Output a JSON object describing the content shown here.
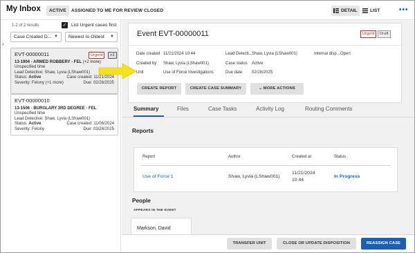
{
  "app": {
    "title": "My Inbox"
  },
  "top_tabs": [
    {
      "label": "ACTIVE"
    },
    {
      "label": "ASSIGNED TO ME FOR REVIEW"
    },
    {
      "label": "CLOSED"
    }
  ],
  "view": {
    "detail_label": "DETAIL",
    "list_label": "LIST",
    "more_label": "•••"
  },
  "left": {
    "results": "1-2 of 2 results",
    "urgent_first_label": "List Urgent cases first",
    "urgent_first_checked": true,
    "sort_field": "Case Created D...",
    "sort_order": "Newest to Oldest",
    "cards": [
      {
        "id": "EVT-00000011",
        "urgent_badge": "Urgent",
        "count_badge": "+1",
        "title": "13-1904 - ARMED ROBBERY - FEL",
        "title_more": "(+2 more)",
        "time": "Unspecified time",
        "detective": "Lead Detective: Shaw, Lyvia (LShaw001)",
        "status_label": "Status:",
        "status": "Active",
        "created": "Case created: 11/21/2024",
        "severity": "Severity: Felony (+1 more)",
        "due": "Due: 02/28/2025"
      },
      {
        "id": "EVT-00000010",
        "title": "13-1506 - BURGLARY 3RD DEGREE - FEL",
        "time": "Unspecified time",
        "detective": "Lead Detective: Shaw, Lyvia (LShaw001)",
        "status_label": "Status:",
        "status": "Active",
        "created": "Case created: 11/06/2024",
        "severity": "Severity: Felony",
        "due": "Due: 03/28/2025"
      }
    ]
  },
  "event": {
    "title": "Event EVT-00000011",
    "badge_urgent": "Urgent",
    "badge_draft": "Draft",
    "fields": {
      "date_created_label": "Date created",
      "date_created": "11/21/2024 10:44",
      "created_by_label": "Created by",
      "created_by": "Shaw, Lyvia (LShaw001)",
      "unit_label": "Unit",
      "unit": "Use of Force Investigations",
      "lead_detective_label": "Lead Detecti...",
      "lead_detective": "Shaw, Lyvia (LShaw001)",
      "case_status_label": "Case status",
      "case_status": "Active",
      "due_date_label": "Due date",
      "due_date": "02/28/2025",
      "internal_label": "Internal disp...",
      "internal": "Open"
    },
    "actions": {
      "create_report": "CREATE REPORT",
      "create_summary": "CREATE CASE SUMMARY",
      "more_actions": "MORE ACTIONS"
    }
  },
  "tabs": [
    {
      "label": "Summary"
    },
    {
      "label": "Files"
    },
    {
      "label": "Case Tasks"
    },
    {
      "label": "Activity Log"
    },
    {
      "label": "Routing Comments"
    }
  ],
  "reports": {
    "title": "Reports",
    "headers": [
      "Report",
      "Author",
      "Created at",
      "Status"
    ],
    "rows": [
      {
        "report": "Use of Force 1",
        "author": "Shaw, Lyvia (LShaw001)",
        "created_date": "11/21/2024",
        "created_time": "10:44",
        "status": "In Progress"
      }
    ]
  },
  "people": {
    "title": "People",
    "appears_label": "APPEARS IN THE EVENT",
    "persons": [
      {
        "name": "Markson, David"
      }
    ]
  },
  "footer": {
    "transfer": "TRANSFER UNIT",
    "close_update": "CLOSE OR UPDATE DISPOSITION",
    "reassign": "REASSIGN CASE"
  },
  "colors": {
    "accent": "#1a5fb4",
    "urgent": "#c62828",
    "annotation_arrow": "#f5e11c"
  }
}
